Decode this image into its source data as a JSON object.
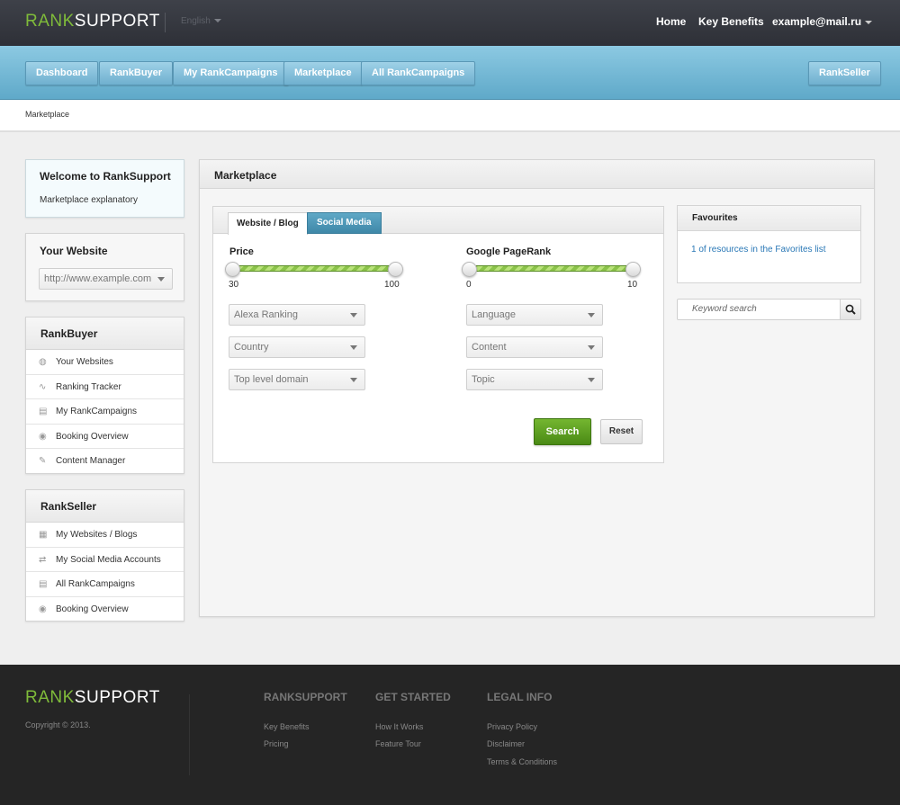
{
  "header": {
    "logo_left": "RANK",
    "logo_right": "SUPPORT",
    "language": "English",
    "nav": [
      "Home",
      "Key Benefits"
    ],
    "user": "example@mail.ru"
  },
  "mainnav": {
    "items": [
      "Dashboard",
      "RankBuyer",
      "My RankCampaigns",
      "Marketplace",
      "All RankCampaigns"
    ],
    "right": "RankSeller"
  },
  "breadcrumb": "Marketplace",
  "sidebar": {
    "welcome_title": "Welcome to RankSupport",
    "welcome_text": "Marketplace explanatory",
    "website_title": "Your Website",
    "website_value": "http://www.example.com",
    "rankbuyer": {
      "title": "RankBuyer",
      "items": [
        {
          "label": "Your Websites",
          "icon": "globe-icon"
        },
        {
          "label": "Ranking Tracker",
          "icon": "pulse-icon"
        },
        {
          "label": "My RankCampaigns",
          "icon": "document-icon"
        },
        {
          "label": "Booking Overview",
          "icon": "eye-icon"
        },
        {
          "label": "Content Manager",
          "icon": "pencil-icon"
        }
      ]
    },
    "rankseller": {
      "title": "RankSeller",
      "items": [
        {
          "label": "My Websites / Blogs",
          "icon": "list-icon"
        },
        {
          "label": "My Social Media Accounts",
          "icon": "social-icon"
        },
        {
          "label": "All RankCampaigns",
          "icon": "document-icon"
        },
        {
          "label": "Booking Overview",
          "icon": "eye-icon"
        }
      ]
    }
  },
  "main": {
    "title": "Marketplace",
    "tabs": [
      "Website / Blog",
      "Social Media"
    ],
    "price": {
      "label": "Price",
      "min": "30",
      "max": "100"
    },
    "pagerank": {
      "label": "Google PageRank",
      "min": "0",
      "max": "10"
    },
    "filters_left": [
      "Alexa Ranking",
      "Country",
      "Top level domain"
    ],
    "filters_right": [
      "Language",
      "Content",
      "Topic"
    ],
    "search_button": "Search",
    "reset_button": "Reset"
  },
  "favourites": {
    "title": "Favourites",
    "link": "1 of resources in the Favorites list"
  },
  "keyword_placeholder": "Keyword search",
  "footer": {
    "copyright": "Copyright © 2013.",
    "col1": {
      "title": "RANKSUPPORT",
      "links": [
        "Key Benefits",
        "Pricing"
      ]
    },
    "col2": {
      "title": "GET STARTED",
      "links": [
        "How It Works",
        "Feature Tour"
      ]
    },
    "col3": {
      "title": "LEGAL INFO",
      "links": [
        "Privacy Policy",
        "Disclaimer",
        "Terms & Conditions"
      ]
    }
  },
  "colors": {
    "brand_green": "#7fbb3a",
    "nav_blue": "#6fb0cf",
    "link_blue": "#2a78b6"
  }
}
